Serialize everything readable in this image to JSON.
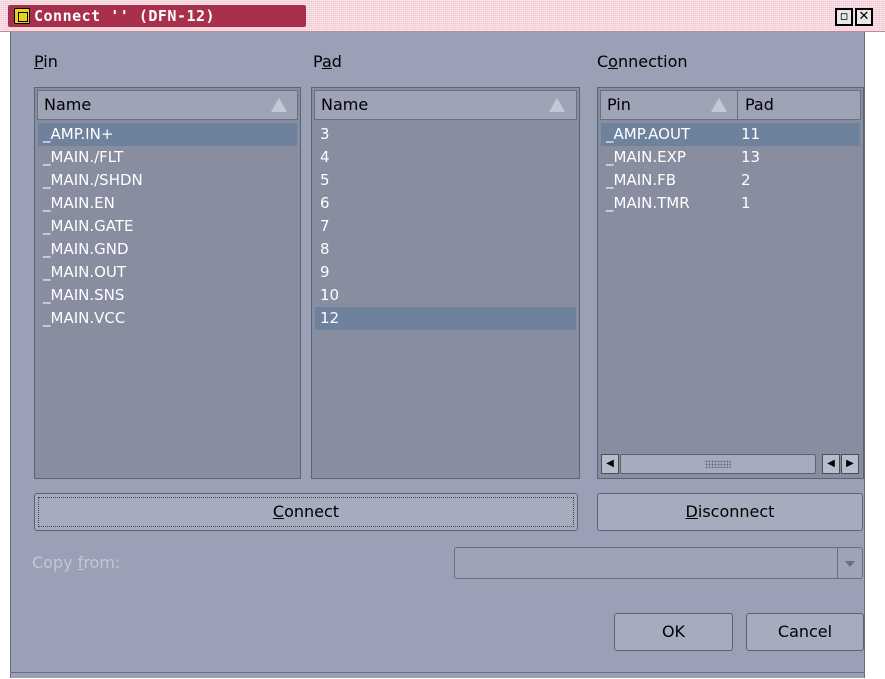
{
  "window": {
    "title": "Connect '' (DFN-12)",
    "restore_glyph": "▫",
    "close_glyph": "✕"
  },
  "pin_section": {
    "label_prefix": "",
    "label_mnemonic": "P",
    "label_rest": "in",
    "column_header": "Name",
    "items": [
      "_AMP.IN+",
      "_MAIN./FLT",
      "_MAIN./SHDN",
      "_MAIN.EN",
      "_MAIN.GATE",
      "_MAIN.GND",
      "_MAIN.OUT",
      "_MAIN.SNS",
      "_MAIN.VCC"
    ],
    "selected_index": 0
  },
  "pad_section": {
    "label_prefix": "P",
    "label_mnemonic": "a",
    "label_rest": "d",
    "column_header": "Name",
    "items": [
      "3",
      "4",
      "5",
      "6",
      "7",
      "8",
      "9",
      "10",
      "12"
    ],
    "selected_index": 8
  },
  "connection_section": {
    "label_prefix": "C",
    "label_mnemonic": "o",
    "label_rest": "nnection",
    "columns": [
      "Pin",
      "Pad"
    ],
    "rows": [
      {
        "pin": "_AMP.AOUT",
        "pad": "11"
      },
      {
        "pin": "_MAIN.EXP",
        "pad": "13"
      },
      {
        "pin": "_MAIN.FB",
        "pad": "2"
      },
      {
        "pin": "_MAIN.TMR",
        "pad": "1"
      }
    ],
    "selected_index": 0
  },
  "buttons": {
    "connect_mnemonic": "C",
    "connect_rest": "onnect",
    "disconnect_mnemonic": "D",
    "disconnect_rest": "isconnect",
    "ok": "OK",
    "cancel": "Cancel"
  },
  "copy_from": {
    "label_prefix": "Copy ",
    "label_mnemonic": "f",
    "label_rest": "rom:",
    "value": ""
  },
  "colors": {
    "titlebar": "#f0c8d2",
    "title_pill": "#a8304c",
    "dialog_bg": "#9aa0b6",
    "list_bg": "#888d9f",
    "selection": "#6e829e"
  }
}
